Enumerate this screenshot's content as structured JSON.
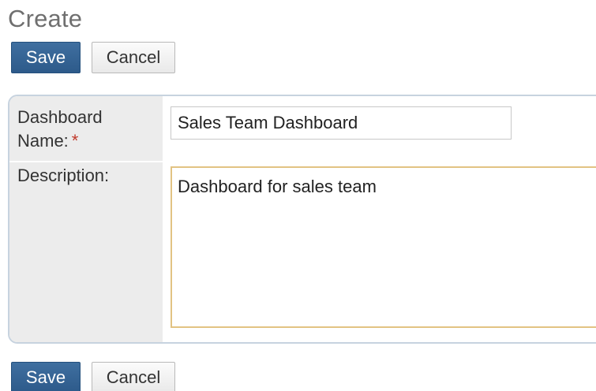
{
  "page": {
    "title": "Create"
  },
  "toolbar_top": {
    "save_label": "Save",
    "cancel_label": "Cancel"
  },
  "form": {
    "dashboard_name": {
      "label": "Dashboard Name:",
      "required_marker": "*",
      "value": "Sales Team Dashboard"
    },
    "description": {
      "label": "Description:",
      "value": "Dashboard for sales team"
    }
  },
  "toolbar_bottom": {
    "save_label": "Save",
    "cancel_label": "Cancel"
  },
  "colors": {
    "save_button": "#2d5a8a",
    "required_marker": "#c0392b",
    "focus_border": "#e2c383"
  }
}
